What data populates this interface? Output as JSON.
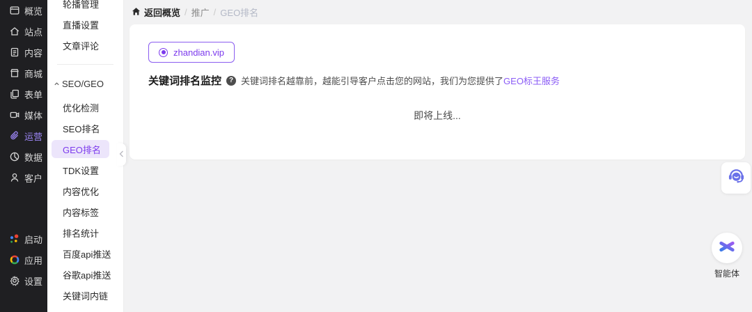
{
  "colors": {
    "accent": "#7c3aed",
    "link": "#8b5cf6",
    "sidebar_bg": "#1f1f22",
    "active_pill_bg": "#ece5fb"
  },
  "sidebar": {
    "items": [
      {
        "label": "概览",
        "icon": "overview-icon"
      },
      {
        "label": "站点",
        "icon": "site-icon"
      },
      {
        "label": "内容",
        "icon": "content-icon"
      },
      {
        "label": "商城",
        "icon": "mall-icon"
      },
      {
        "label": "表单",
        "icon": "form-icon"
      },
      {
        "label": "媒体",
        "icon": "media-icon"
      },
      {
        "label": "运营",
        "icon": "operation-icon",
        "active": true
      },
      {
        "label": "数据",
        "icon": "data-icon"
      },
      {
        "label": "客户",
        "icon": "customer-icon"
      }
    ],
    "bottom_items": [
      {
        "label": "启动",
        "icon": "launch-icon"
      },
      {
        "label": "应用",
        "icon": "apps-icon"
      },
      {
        "label": "设置",
        "icon": "settings-icon"
      }
    ]
  },
  "submenu": {
    "top_items": [
      "轮播管理",
      "直播设置",
      "文章评论"
    ],
    "group_label": "SEO/GEO",
    "group_items": [
      "优化检测",
      "SEO排名",
      "GEO排名",
      "TDK设置",
      "内容优化",
      "内容标签",
      "排名统计",
      "百度api推送",
      "谷歌api推送",
      "关键词内链"
    ],
    "active_item": "GEO排名"
  },
  "breadcrumb": {
    "home_label": "返回概览",
    "separator": "/",
    "crumb1": "推广",
    "crumb2": "GEO排名"
  },
  "content": {
    "site_tab_label": "zhandian.vip",
    "section_title": "关键词排名监控",
    "help_glyph": "?",
    "description": "关键词排名越靠前，越能引导客户点击您的网站，我们为您提供了",
    "service_link": "GEO标王服务",
    "coming_soon": "即将上线..."
  },
  "floating": {
    "agent_label": "智能体"
  }
}
